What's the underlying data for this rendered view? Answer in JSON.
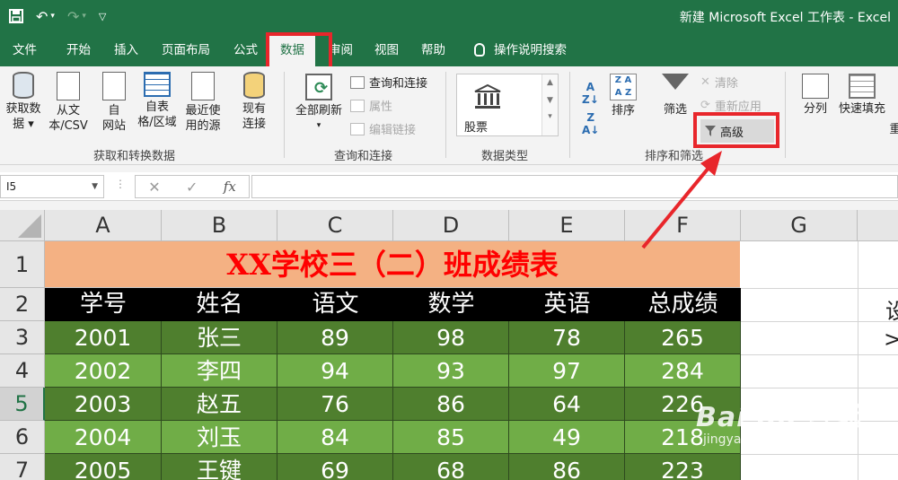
{
  "titlebar": {
    "title": "新建 Microsoft Excel 工作表 - Excel",
    "qat": {
      "save_icon": "save-icon",
      "undo_icon": "undo-icon",
      "redo_icon": "redo-icon",
      "customize_icon": "customize-qat-icon"
    }
  },
  "tabs": [
    {
      "label": "文件"
    },
    {
      "label": "开始"
    },
    {
      "label": "插入"
    },
    {
      "label": "页面布局"
    },
    {
      "label": "公式"
    },
    {
      "label": "数据",
      "active": true
    },
    {
      "label": "审阅"
    },
    {
      "label": "视图"
    },
    {
      "label": "帮助"
    },
    {
      "label": "操作说明搜索"
    }
  ],
  "ribbon": {
    "get_transform": {
      "label": "获取和转换数据",
      "get_data": [
        "获取数",
        "据"
      ],
      "from_text": [
        "从文",
        "本/CSV"
      ],
      "from_web": [
        "自",
        "网站"
      ],
      "from_table": [
        "自表",
        "格/区域"
      ],
      "recent_sources": [
        "最近使",
        "用的源"
      ],
      "existing": [
        "现有",
        "连接"
      ]
    },
    "queries": {
      "label": "查询和连接",
      "refresh_all": "全部刷新",
      "queries_connections": "查询和连接",
      "properties": "属性",
      "edit_links": "编辑链接"
    },
    "data_types": {
      "label": "数据类型",
      "stocks": "股票"
    },
    "sort_filter": {
      "label": "排序和筛选",
      "sort": "排序",
      "filter": "筛选",
      "clear": "清除",
      "reapply": "重新应用",
      "advanced": "高级"
    },
    "tools": {
      "text_to_columns": "分列",
      "flash_fill": "快速填充",
      "partial": "重"
    }
  },
  "formula_bar": {
    "name_box": "I5",
    "fx": "fx",
    "formula": ""
  },
  "columns": [
    "A",
    "B",
    "C",
    "D",
    "E",
    "F",
    "G"
  ],
  "rows": [
    "1",
    "2",
    "3",
    "4",
    "5",
    "6",
    "7"
  ],
  "selected_row": "5",
  "sheet": {
    "title": "XX学校三（二）班成绩表",
    "headers": [
      "学号",
      "姓名",
      "语文",
      "数学",
      "英语",
      "总成绩"
    ],
    "data": [
      [
        "2001",
        "张三",
        "89",
        "98",
        "78",
        "265"
      ],
      [
        "2002",
        "李四",
        "94",
        "93",
        "97",
        "284"
      ],
      [
        "2003",
        "赵五",
        "76",
        "86",
        "64",
        "226"
      ],
      [
        "2004",
        "刘玉",
        "84",
        "85",
        "49",
        "218"
      ],
      [
        "2005",
        "王键",
        "69",
        "68",
        "86",
        "223"
      ]
    ],
    "right_overflow": [
      "设",
      ">"
    ]
  },
  "colors": {
    "excel_green": "#217346",
    "title_fill": "#f4b183",
    "title_text": "#ff0000",
    "row_dark": "#4f7f2e",
    "row_light": "#70ad47",
    "highlight_red": "#e8262b"
  },
  "watermark": {
    "main": "Bai du 经验",
    "sub": "jingyan.baidu.com"
  }
}
